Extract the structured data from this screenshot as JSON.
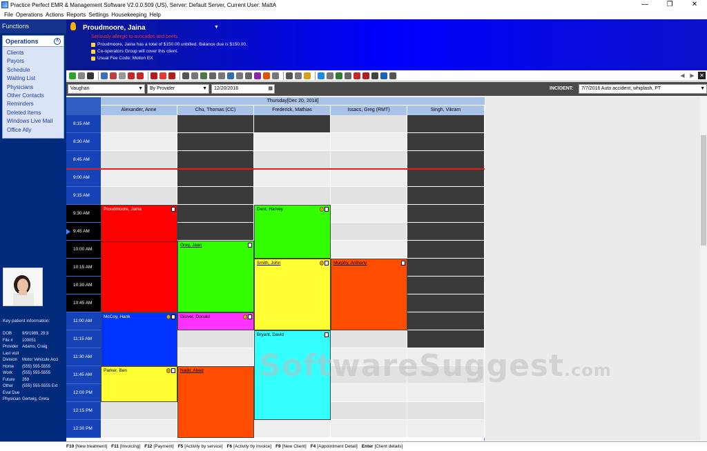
{
  "window": {
    "title": "Practice Perfect EMR & Management Software V2.0.0.509 (US), Server: Default Server, Current User: MattA",
    "controls": [
      "—",
      "❐",
      "✕"
    ]
  },
  "menu": [
    "File",
    "Operations",
    "Actions",
    "Reports",
    "Settings",
    "Housekeeping",
    "Help"
  ],
  "sidebar": {
    "functions_label": "Functions",
    "ops_title": "Operations",
    "items": [
      "Clients",
      "Payors",
      "Schedule",
      "Waiting List",
      "Physicians",
      "Other Contacts",
      "Reminders",
      "Deleted Items",
      "Windows Live Mail",
      "Office Ally"
    ],
    "key_info_title": "Key patient information:",
    "key_info": [
      {
        "k": "DOB",
        "v": "9/9/1989, 29:3"
      },
      {
        "k": "File #",
        "v": "100051"
      },
      {
        "k": "Provider",
        "v": "Adams, Craig"
      },
      {
        "k": "Last visit",
        "v": ""
      },
      {
        "k": "Division",
        "v": "Motor Vehicule Acci"
      },
      {
        "k": "Home",
        "v": "(555) 555-5555"
      },
      {
        "k": "Work",
        "v": "(555) 555-5555"
      },
      {
        "k": "Future",
        "v": "269"
      },
      {
        "k": "Other",
        "v": "(555) 555-5555 Ext"
      },
      {
        "k": "Eval Due",
        "v": ""
      },
      {
        "k": "Physician",
        "v": "Gertwig, Greta"
      }
    ]
  },
  "patient": {
    "name": "Proudmoore, Jaina",
    "alert": "Seriously allergic to avocados and beets",
    "lines": [
      "Proudmoore, Jaina has a total of $150.00 unbilled. Balance due is $150.00.",
      "Co-operators Group will cover this client.",
      "Usual Fee Code: Motion EX"
    ]
  },
  "filters": {
    "provider": "Vaughan",
    "mode": "By Provider",
    "date": "12/20/2018",
    "incident_label": "INCIDENT:",
    "incident": "7/7/2016 Auto accident, whiplash, PT"
  },
  "calendar": {
    "day": "Thursday[Dec 20, 2018]",
    "columns": [
      "Alexander, Anne",
      "Chu, Thomas (CC)",
      "Frederick, Mathias",
      "Issacs, Greg (RMT)",
      "Singh, Vikram"
    ],
    "times": [
      "8:15 AM",
      "8:30 AM",
      "8:45 AM",
      "9:00 AM",
      "9:15 AM",
      "9:30 AM",
      "9:45 AM",
      "10:00 AM",
      "10:15 AM",
      "10:30 AM",
      "10:45 AM",
      "11:00 AM",
      "11:15 AM",
      "11:30 AM",
      "11:45 AM",
      "12:00 PM",
      "12:15 PM",
      "12:30 PM"
    ],
    "appointments": [
      {
        "name": "Proudmoore, Jaina",
        "col": 0,
        "start": 5,
        "span": 6,
        "color": "#ff0000",
        "textColor": "#ffffff",
        "icons": [
          "doc"
        ]
      },
      {
        "name": "Grey, Jean",
        "col": 1,
        "start": 7,
        "span": 4,
        "color": "#33ff00",
        "textColor": "#000000",
        "icons": [
          "doc"
        ],
        "underline": true
      },
      {
        "name": "Dent, Harvey",
        "col": 2,
        "start": 5,
        "span": 3,
        "color": "#33ff00",
        "textColor": "#000000",
        "icons": [
          "money",
          "doc"
        ]
      },
      {
        "name": "Smith, John",
        "col": 2,
        "start": 8,
        "span": 4,
        "color": "#ffff33",
        "textColor": "#000000",
        "icons": [
          "money",
          "doc"
        ],
        "underline": true
      },
      {
        "name": "Murphy, Anthony",
        "col": 3,
        "start": 8,
        "span": 4,
        "color": "#ff4d00",
        "textColor": "#000000",
        "icons": [
          "doc"
        ],
        "underline": true
      },
      {
        "name": "McCoy, Hank",
        "col": 0,
        "start": 11,
        "span": 3,
        "color": "#0033ff",
        "textColor": "#ffffff",
        "icons": [
          "money",
          "doc"
        ]
      },
      {
        "name": "Glover, Donald",
        "col": 1,
        "start": 11,
        "span": 1,
        "color": "#ff33ff",
        "textColor": "#000000",
        "icons": [
          "money",
          "doc"
        ]
      },
      {
        "name": "Bryant, David",
        "col": 2,
        "start": 12,
        "span": 5,
        "color": "#33ffff",
        "textColor": "#000000",
        "icons": [
          "doc"
        ]
      },
      {
        "name": "Parker, Ben",
        "col": 0,
        "start": 14,
        "span": 2,
        "color": "#ffff33",
        "textColor": "#000000",
        "icons": [
          "money",
          "doc"
        ]
      },
      {
        "name": "Nadir, Abed",
        "col": 1,
        "start": 14,
        "span": 4,
        "color": "#ff4d00",
        "textColor": "#000000",
        "icons": [],
        "underline": true
      }
    ]
  },
  "watermark": {
    "main": "SoftwareSuggest",
    "suffix": ".com"
  },
  "hotkeys": [
    {
      "key": "F10",
      "label": "[New treatment]"
    },
    {
      "key": "F11",
      "label": "[Invoicing]"
    },
    {
      "key": "F12",
      "label": "[Payment]"
    },
    {
      "key": "F5",
      "label": "[Activity by service]"
    },
    {
      "key": "F6",
      "label": "[Activity by invoice]"
    },
    {
      "key": "F9",
      "label": "[New Client]"
    },
    {
      "key": "F4",
      "label": "[Appointment Detail]"
    },
    {
      "key": "Enter",
      "label": "[Client details]"
    }
  ]
}
